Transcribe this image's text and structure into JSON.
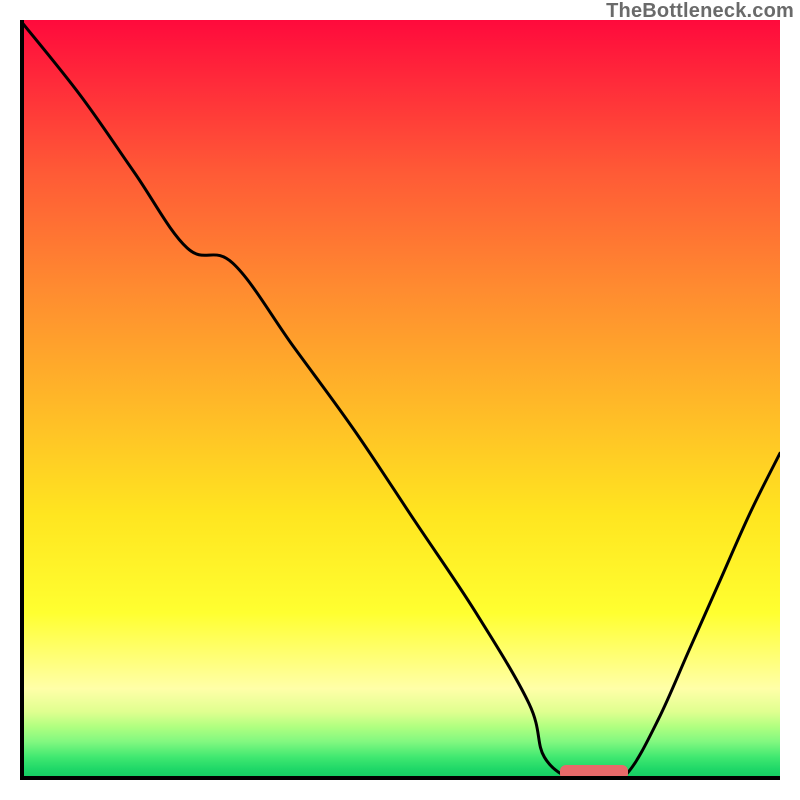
{
  "watermark": "TheBottleneck.com",
  "chart_data": {
    "type": "line",
    "title": "",
    "xlabel": "",
    "ylabel": "",
    "xlim": [
      0,
      100
    ],
    "ylim": [
      0,
      100
    ],
    "x": [
      0,
      8,
      15,
      22,
      28,
      36,
      44,
      52,
      60,
      67,
      69,
      73,
      77,
      80,
      84,
      88,
      92,
      96,
      100
    ],
    "values": [
      100,
      90,
      80,
      70,
      68,
      57,
      46,
      34,
      22,
      10,
      3,
      0,
      0,
      1,
      8,
      17,
      26,
      35,
      43
    ],
    "marker": {
      "x_start": 71,
      "x_end": 80,
      "y": 0,
      "height": 2
    },
    "gradient_stops": [
      {
        "pos": 0,
        "color": "#ff0a3c"
      },
      {
        "pos": 0.35,
        "color": "#ff8a30"
      },
      {
        "pos": 0.65,
        "color": "#ffe520"
      },
      {
        "pos": 0.88,
        "color": "#ffffa8"
      },
      {
        "pos": 1.0,
        "color": "#10c860"
      }
    ]
  }
}
